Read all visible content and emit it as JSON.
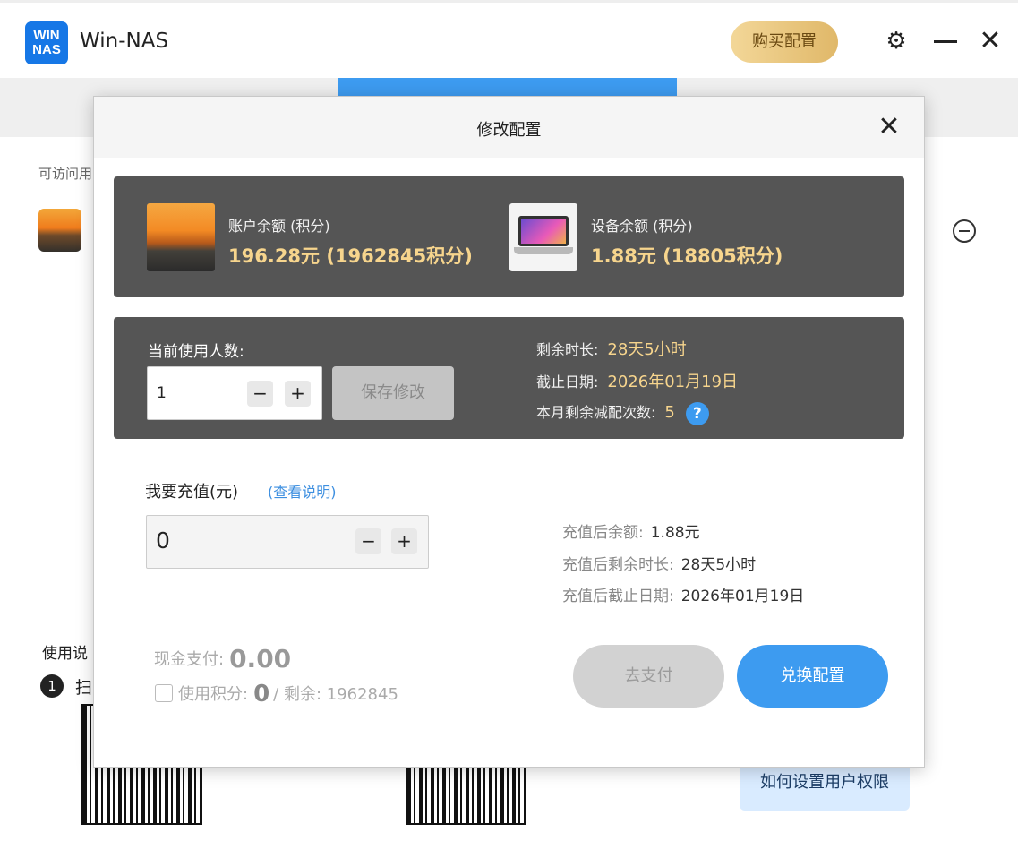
{
  "app": {
    "logo_text": "WIN NAS",
    "title": "Win-NAS"
  },
  "header": {
    "buy_label": "购买配置",
    "settings_icon": "gear-icon",
    "minimize_icon": "minimize-icon",
    "close_icon": "close-icon"
  },
  "background": {
    "accessible_label": "可访问用",
    "guide_label": "使用说",
    "step_number": "1",
    "step_text": "扫",
    "help_button": "如何设置用户权限"
  },
  "modal": {
    "title": "修改配置",
    "close_icon": "close-icon",
    "account": {
      "label": "账户余额 (积分)",
      "value": "196.28元 (1962845积分)"
    },
    "device": {
      "label": "设备余额 (积分)",
      "value": "1.88元 (18805积分)"
    },
    "users": {
      "label": "当前使用人数:",
      "value": "1",
      "minus": "−",
      "plus": "+",
      "save_label": "保存修改"
    },
    "status": {
      "remaining_label": "剩余时长:",
      "remaining_value": "28天5小时",
      "deadline_label": "截止日期:",
      "deadline_value": "2026年01月19日",
      "reduce_label": "本月剩余减配次数:",
      "reduce_value": "5",
      "help": "?"
    },
    "recharge": {
      "label": "我要充值(元)",
      "note_link": "(查看说明)",
      "value": "0",
      "minus": "−",
      "plus": "+"
    },
    "after": {
      "balance_label": "充值后余额:",
      "balance_value": "1.88元",
      "remaining_label": "充值后剩余时长:",
      "remaining_value": "28天5小时",
      "deadline_label": "充值后截止日期:",
      "deadline_value": "2026年01月19日"
    },
    "payment": {
      "cash_label": "现金支付:",
      "cash_value": "0.00",
      "points_label": "使用积分:",
      "points_value": "0",
      "points_remaining": "/ 剩余: 1962845",
      "pay_label": "去支付",
      "exchange_label": "兑换配置"
    }
  },
  "colors": {
    "accent": "#3d9bf0",
    "panel": "#555555",
    "gold": "#f7d58d"
  }
}
